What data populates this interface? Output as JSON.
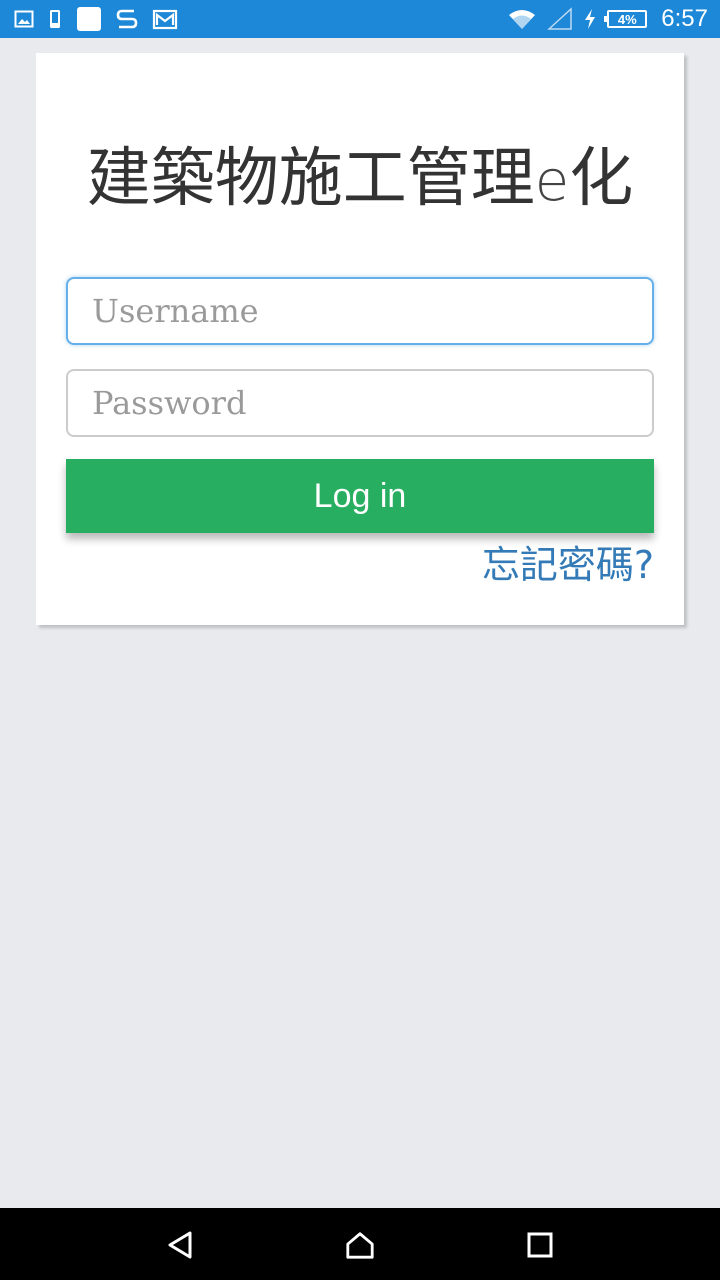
{
  "status_bar": {
    "time": "6:57",
    "battery_percent": "4%",
    "left_icons": [
      "image-icon",
      "phone-icon",
      "app-square-icon",
      "s-app-icon",
      "gmail-icon"
    ],
    "right_icons": [
      "wifi-icon",
      "signal-icon",
      "charging-icon",
      "battery-icon"
    ],
    "color": "#1e88d8"
  },
  "login": {
    "title_main": "建築物施工管理",
    "title_e": "e",
    "title_end": "化",
    "username_placeholder": "Username",
    "password_placeholder": "Password",
    "login_label": "Log in",
    "forgot_label": "忘記密碼?",
    "button_color": "#27ae60",
    "link_color": "#337ab7"
  },
  "nav_bar": {
    "icons": [
      "back-icon",
      "home-icon",
      "recent-apps-icon"
    ]
  }
}
